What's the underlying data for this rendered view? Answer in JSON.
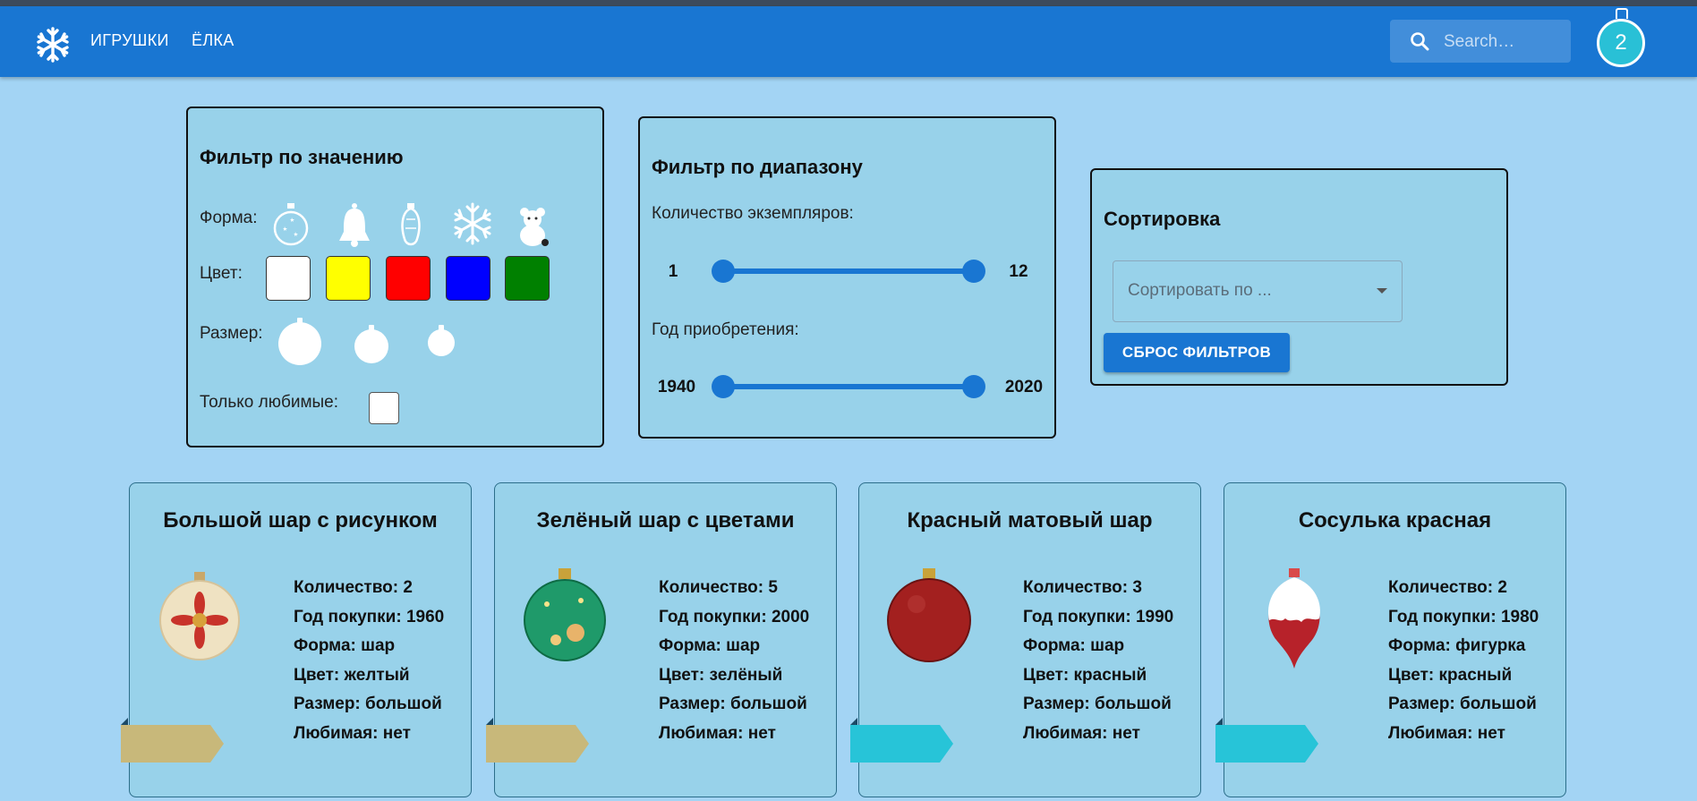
{
  "header": {
    "logo_icon": "snowflake-icon",
    "nav": [
      "ИГРУШКИ",
      "ЁЛКА"
    ],
    "search_placeholder": "Search…",
    "cart_count": "2"
  },
  "filter_value": {
    "title": "Фильтр по значению",
    "shape_label": "Форма:",
    "shapes": [
      "ball-icon",
      "bell-icon",
      "cone-icon",
      "snowflake-icon",
      "figure-icon"
    ],
    "color_label": "Цвет:",
    "colors": [
      "#ffffff",
      "#ffff00",
      "#ff0000",
      "#0000ff",
      "#008000"
    ],
    "size_label": "Размер:",
    "favorite_label": "Только любимые:"
  },
  "filter_range": {
    "title": "Фильтр по диапазону",
    "count_label": "Количество экземпляров:",
    "count_min": "1",
    "count_max": "12",
    "year_label": "Год приобретения:",
    "year_min": "1940",
    "year_max": "2020"
  },
  "sort": {
    "title": "Сортировка",
    "placeholder": "Сортировать по ...",
    "reset_label": "СБРОС ФИЛЬТРОВ"
  },
  "cards": [
    {
      "title": "Большой шар с рисунком",
      "count": "Количество: 2",
      "year": "Год покупки: 1960",
      "shape": "Форма: шар",
      "color": "Цвет: желтый",
      "size": "Размер: большой",
      "favorite": "Любимая: нет",
      "ribbon_color": "#c8b87a"
    },
    {
      "title": "Зелёный шар с цветами",
      "count": "Количество: 5",
      "year": "Год покупки: 2000",
      "shape": "Форма: шар",
      "color": "Цвет: зелёный",
      "size": "Размер: большой",
      "favorite": "Любимая: нет",
      "ribbon_color": "#c8b87a"
    },
    {
      "title": "Красный матовый шар",
      "count": "Количество: 3",
      "year": "Год покупки: 1990",
      "shape": "Форма: шар",
      "color": "Цвет: красный",
      "size": "Размер: большой",
      "favorite": "Любимая: нет",
      "ribbon_color": "#27c4d8"
    },
    {
      "title": "Сосулька красная",
      "count": "Количество: 2",
      "year": "Год покупки: 1980",
      "shape": "Форма: фигурка",
      "color": "Цвет: красный",
      "size": "Размер: большой",
      "favorite": "Любимая: нет",
      "ribbon_color": "#27c4d8"
    }
  ]
}
